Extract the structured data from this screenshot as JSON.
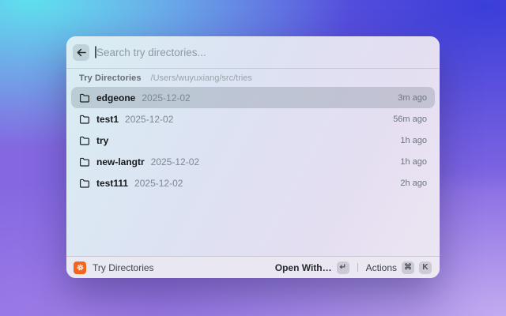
{
  "window": {
    "search": {
      "placeholder": "Search try directories..."
    },
    "header": {
      "section_label": "Try Directories",
      "path": "/Users/wuyuxiang/src/tries"
    },
    "list": {
      "items": [
        {
          "name": "edgeone",
          "date": "2025-12-02",
          "time": "3m ago",
          "selected": true
        },
        {
          "name": "test1",
          "date": "2025-12-02",
          "time": "56m ago",
          "selected": false
        },
        {
          "name": "try",
          "date": "",
          "time": "1h ago",
          "selected": false
        },
        {
          "name": "new-langtr",
          "date": "2025-12-02",
          "time": "1h ago",
          "selected": false
        },
        {
          "name": "test111",
          "date": "2025-12-02",
          "time": "2h ago",
          "selected": false
        }
      ]
    },
    "footer": {
      "app_name": "Try Directories",
      "primary_action_label": "Open With…",
      "primary_action_key": "↵",
      "actions_label": "Actions",
      "actions_keys": [
        "⌘",
        "K"
      ]
    },
    "colors": {
      "accent_orange": "#F4641D",
      "selection_overlay": "rgba(105,117,130,0.27)"
    }
  }
}
